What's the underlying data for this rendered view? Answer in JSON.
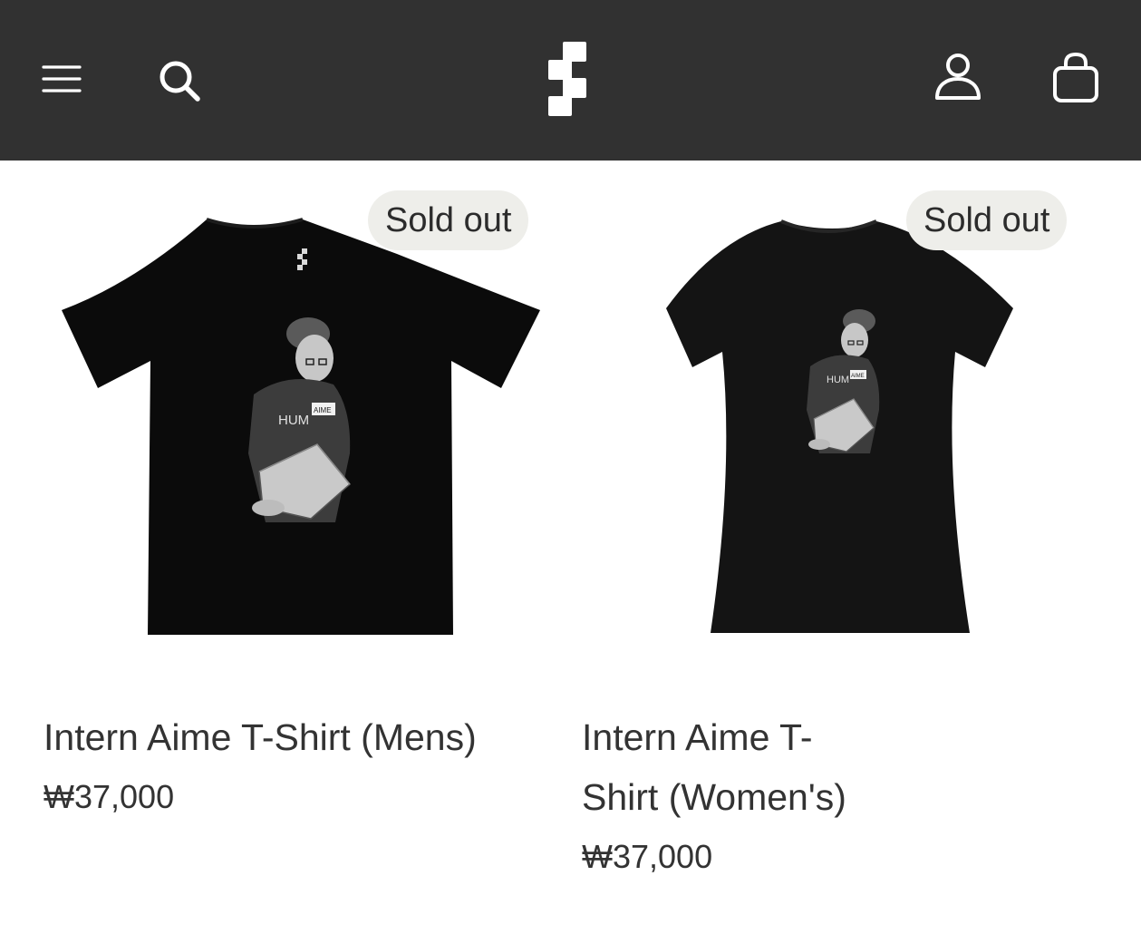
{
  "header": {
    "menu_icon": "hamburger-menu-icon",
    "search_icon": "search-icon",
    "logo_icon": "brand-logo-icon",
    "account_icon": "account-icon",
    "cart_icon": "shopping-bag-icon",
    "background_color": "#313131"
  },
  "products": [
    {
      "title": "Intern Aime T-Shirt (Mens)",
      "price": "₩37,000",
      "badge": "Sold out",
      "image_text_1": "HUM",
      "image_text_2": "AIME"
    },
    {
      "title": "Intern Aime T-Shirt (Women's)",
      "price": "₩37,000",
      "badge": "Sold out",
      "image_text_1": "HUM",
      "image_text_2": "AIME"
    }
  ],
  "colors": {
    "badge_bg": "#eeeeea",
    "text": "#333333",
    "shirt": "#0b0b0b"
  }
}
